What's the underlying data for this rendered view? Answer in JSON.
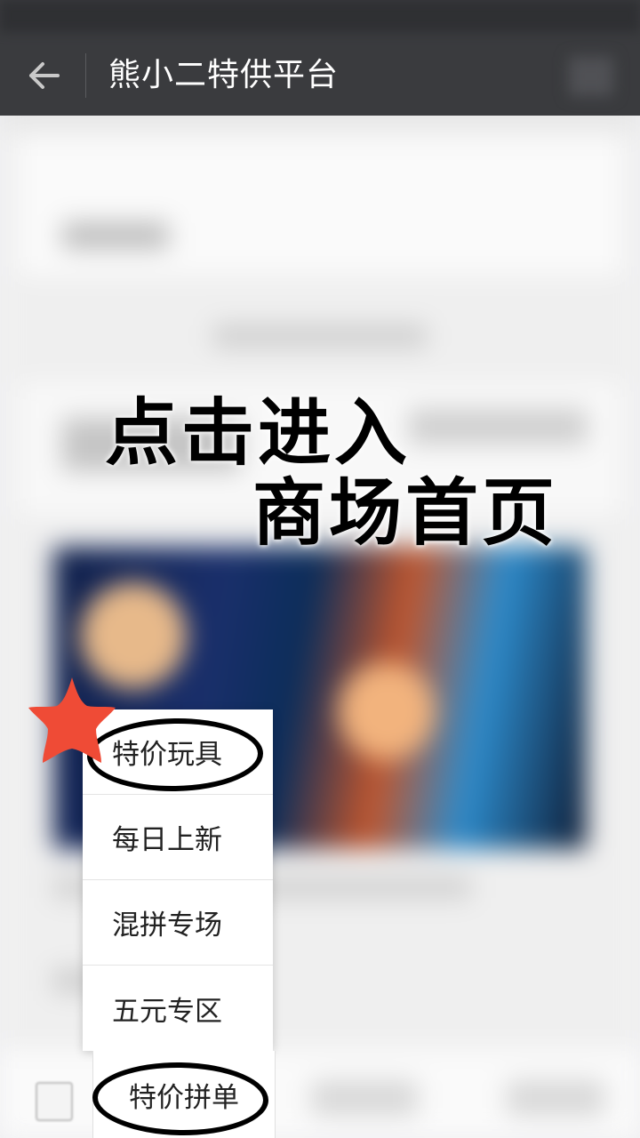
{
  "title_bar": {
    "title": "熊小二特供平台",
    "back_icon": "arrow-left-icon"
  },
  "instruction": {
    "line1": "点击进入",
    "line2": "商场首页"
  },
  "menu": {
    "items": [
      {
        "label": "特价玩具"
      },
      {
        "label": "每日上新"
      },
      {
        "label": "混拼专场"
      },
      {
        "label": "五元专区"
      }
    ]
  },
  "bottom_bar": {
    "active_tab_label": "特价拼单"
  },
  "colors": {
    "title_bar_bg": "#3a3b3e",
    "title_text": "#ffffff",
    "star_mark": "#ef4b36",
    "annotation_circle": "#000000"
  }
}
